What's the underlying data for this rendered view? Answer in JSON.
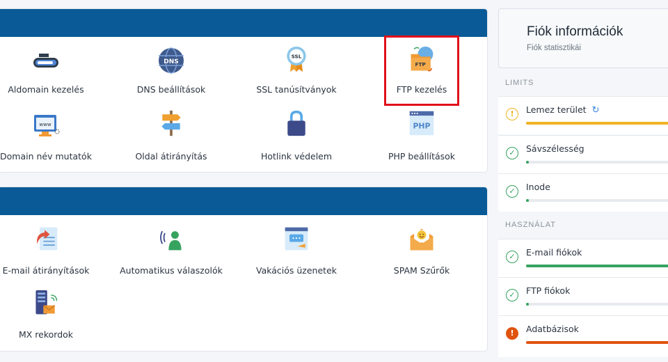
{
  "domain_panel": {
    "tiles": [
      {
        "label": "Aldomain kezelés",
        "icon": "subdomain-icon"
      },
      {
        "label": "DNS beállítások",
        "icon": "dns-globe-icon",
        "icon_text": "DNS"
      },
      {
        "label": "SSL tanúsítványok",
        "icon": "ssl-badge-icon",
        "icon_text": "SSL"
      },
      {
        "label": "FTP kezelés",
        "icon": "ftp-folder-icon",
        "icon_text": "FTP"
      },
      {
        "label": "Domain név mutatók",
        "icon": "domain-pointer-icon",
        "icon_text": "www"
      },
      {
        "label": "Oldal átirányítás",
        "icon": "signpost-icon"
      },
      {
        "label": "Hotlink védelem",
        "icon": "padlock-icon"
      },
      {
        "label": "PHP beállítások",
        "icon": "php-window-icon",
        "icon_text": "PHP"
      }
    ]
  },
  "email_panel": {
    "tiles": [
      {
        "label": "E-mail átirányítások",
        "icon": "email-forward-icon"
      },
      {
        "label": "Automatikus válaszolók",
        "icon": "autoresponder-icon"
      },
      {
        "label": "Vakációs üzenetek",
        "icon": "vacation-message-icon"
      },
      {
        "label": "SPAM Szűrők",
        "icon": "spam-filter-icon"
      },
      {
        "label": "MX rekordok",
        "icon": "mx-records-icon"
      }
    ]
  },
  "account": {
    "title": "Fiók információk",
    "subtitle": "Fiók statisztikái",
    "limits_label": "LIMITS",
    "usage_label": "HASZNÁLAT",
    "limits": [
      {
        "name": "Lemez terület",
        "status": "warn",
        "fill": 1.0,
        "color": "#f0b323",
        "refresh": "↻"
      },
      {
        "name": "Sávszélesség",
        "status": "ok",
        "fill": 0.02,
        "color": "#36a35f"
      },
      {
        "name": "Inode",
        "status": "ok",
        "fill": 0.02,
        "color": "#36a35f"
      }
    ],
    "usage": [
      {
        "name": "E-mail fiókok",
        "status": "ok",
        "fill": 1.0,
        "color": "#36a35f"
      },
      {
        "name": "FTP fiókok",
        "status": "ok",
        "fill": 0.02,
        "color": "#36a35f"
      },
      {
        "name": "Adatbázisok",
        "status": "err",
        "fill": 1.0,
        "color": "#e0530f"
      }
    ]
  },
  "colors": {
    "panel_header": "#095a96",
    "highlight": "#e0101a"
  }
}
